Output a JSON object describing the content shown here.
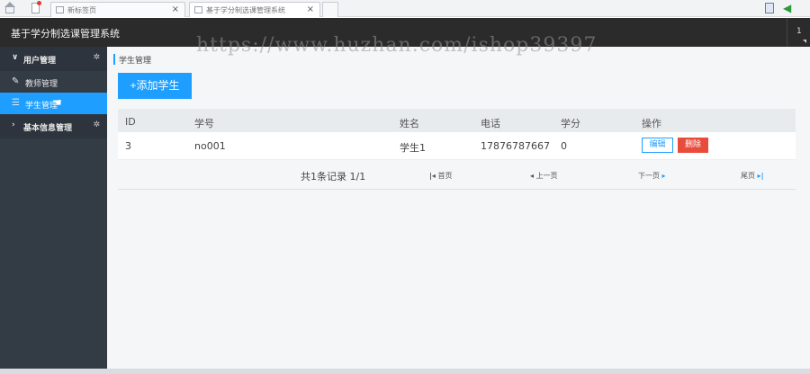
{
  "browser": {
    "tabs": [
      {
        "label": "新标签页",
        "close": "×"
      },
      {
        "label": "基于学分制选课管理系统",
        "close": "×"
      }
    ]
  },
  "header": {
    "title": "基于学分制选课管理系统",
    "right_badge": "1"
  },
  "sidebar": {
    "groups": [
      {
        "label": "用户管理",
        "items": [
          {
            "label": "教师管理",
            "icon": "pencil-icon"
          },
          {
            "label": "学生管理",
            "icon": "list-icon",
            "active": true
          }
        ]
      },
      {
        "label": "基本信息管理",
        "items": []
      }
    ]
  },
  "breadcrumb": "学生管理",
  "toolbar": {
    "add_label": "+添加学生"
  },
  "table": {
    "headers": [
      "ID",
      "学号",
      "姓名",
      "电话",
      "学分",
      "操作"
    ],
    "rows": [
      {
        "id": "3",
        "no": "no001",
        "name": "学生1",
        "tel": "17876787667",
        "score": "0",
        "edit": "编辑",
        "delete": "删除"
      }
    ]
  },
  "pager": {
    "count": "共1条记录 1/1",
    "first": "首页",
    "prev": "上一页",
    "next": "下一页",
    "last": "尾页"
  },
  "watermark": "https://www.huzhan.com/ishop39397",
  "colors": {
    "accent": "#1e9fff",
    "danger": "#e84c3d",
    "sidebar": "#333b45",
    "header": "#2b2b2b"
  }
}
